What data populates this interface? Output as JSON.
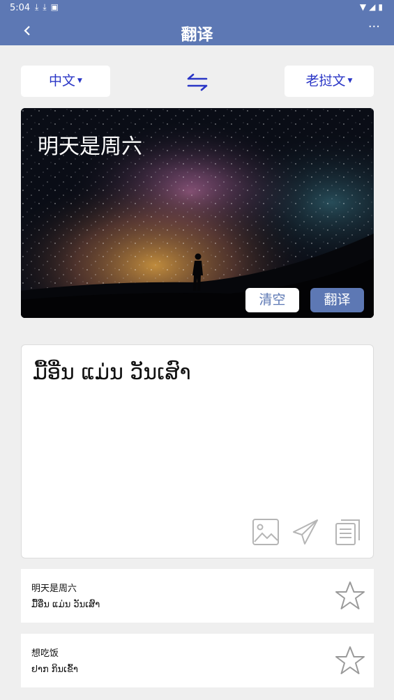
{
  "status_bar": {
    "time": "5:04",
    "left_icons": [
      "download-icon",
      "download-icon",
      "app-notification-icon"
    ],
    "right_icons": [
      "wifi-icon",
      "signal-icon",
      "battery-icon"
    ]
  },
  "app_bar": {
    "title": "翻译",
    "more_label": "···"
  },
  "languages": {
    "source": "中文",
    "target": "老挝文"
  },
  "input": {
    "text": "明天是周六",
    "clear_label": "清空",
    "translate_label": "翻译"
  },
  "result": {
    "text": "ມື້ອື່ນ ແມ່ນ ວັນເສົາ",
    "tools": [
      "image-icon",
      "send-icon",
      "copy-icon"
    ]
  },
  "history": [
    {
      "source": "明天是周六",
      "target": "ມື້ອື່ນ ແມ່ນ ວັນເສົາ"
    },
    {
      "source": "想吃饭",
      "target": "ຢາກ ກິນເຂົ້າ"
    }
  ],
  "colors": {
    "primary": "#5d78b4",
    "language_text": "#2a36c6",
    "background": "#efefef",
    "icon_gray": "#b5b5b5"
  }
}
